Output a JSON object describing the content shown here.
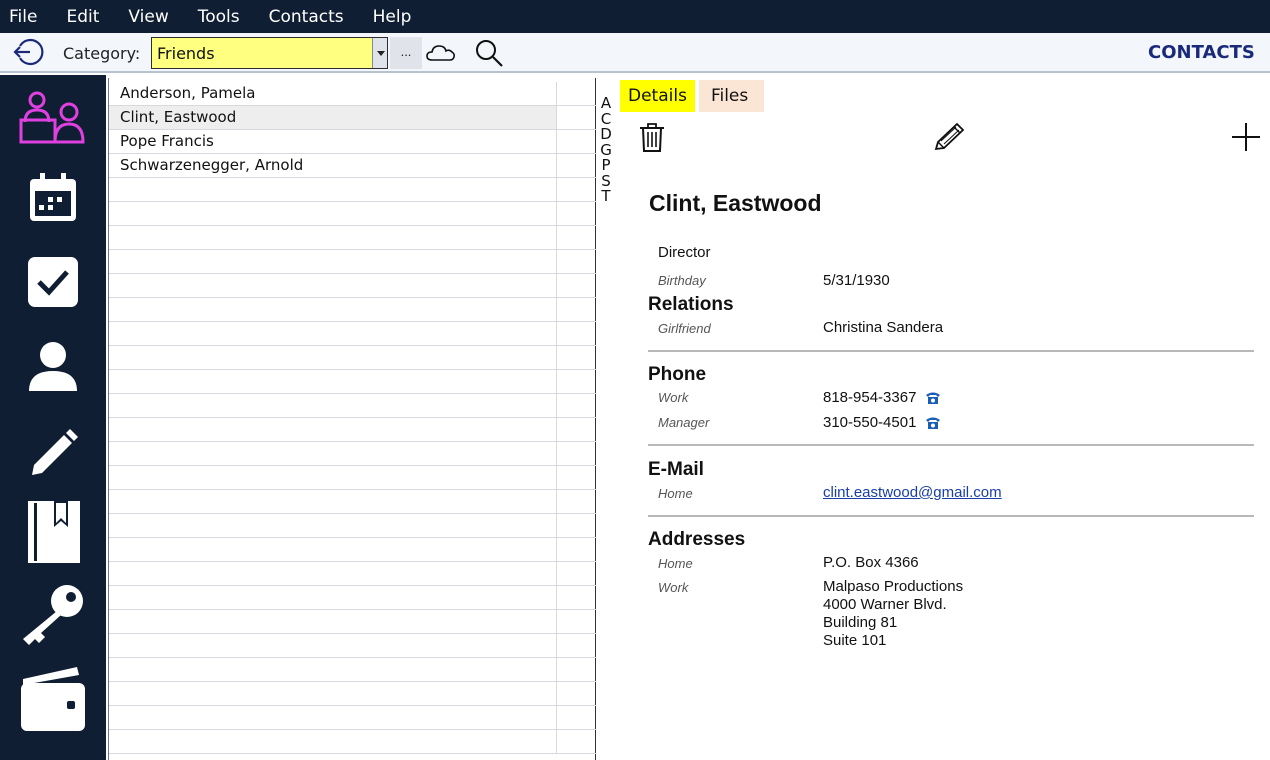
{
  "menu": [
    "File",
    "Edit",
    "View",
    "Tools",
    "Contacts",
    "Help"
  ],
  "toolbar": {
    "category_label": "Category:",
    "category_value": "Friends",
    "more_label": "...",
    "app_title": "CONTACTS"
  },
  "nav_icons": [
    "reception-icon",
    "calendar-icon",
    "tasks-icon",
    "contact-icon",
    "notes-icon",
    "bookmark-book-icon",
    "key-icon",
    "wallet-icon"
  ],
  "contacts": [
    {
      "name": "Anderson, Pamela",
      "selected": false
    },
    {
      "name": "Clint, Eastwood",
      "selected": true
    },
    {
      "name": "Pope Francis",
      "selected": false
    },
    {
      "name": "Schwarzenegger, Arnold",
      "selected": false
    }
  ],
  "alphabet": [
    "A",
    "C",
    "D",
    "G",
    "P",
    "S",
    "T"
  ],
  "tabs": {
    "details": "Details",
    "files": "Files"
  },
  "detail": {
    "name": "Clint, Eastwood",
    "job": "Director",
    "birthday_label": "Birthday",
    "birthday": "5/31/1930",
    "relations_title": "Relations",
    "relation_label": "Girlfriend",
    "relation_value": "Christina Sandera",
    "phone_title": "Phone",
    "phones": [
      {
        "label": "Work",
        "value": "818-954-3367"
      },
      {
        "label": "Manager",
        "value": "310-550-4501"
      }
    ],
    "email_title": "E-Mail",
    "email_label": "Home",
    "email_value": "clint.eastwood@gmail.com",
    "addresses_title": "Addresses",
    "address_home_label": "Home",
    "address_home": "P.O. Box 4366",
    "address_work_label": "Work",
    "address_work": [
      "Malpaso Productions",
      "4000 Warner Blvd.",
      "Building 81",
      "Suite 101"
    ]
  },
  "colors": {
    "chrome": "#0f1e33",
    "nav_icon": "#ffffff",
    "active_nav_icon": "#e040e0",
    "category_bg": "#ffff80",
    "active_tab": "#ffff00",
    "files_tab": "#fbe6d6",
    "title_blue": "#1a2a7a",
    "link": "#1a3ea8"
  }
}
